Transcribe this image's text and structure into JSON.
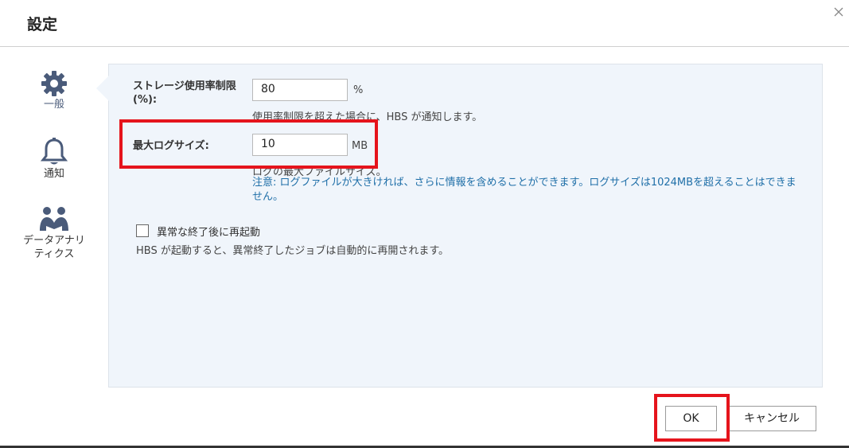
{
  "dialog": {
    "title": "設定"
  },
  "nav": {
    "items": [
      {
        "label": "一般",
        "icon": "gear-icon",
        "active": true
      },
      {
        "label": "通知",
        "icon": "bell-icon",
        "active": false
      },
      {
        "label_line1": "データアナリ",
        "label_line2": "ティクス",
        "icon": "people-icon",
        "active": false
      }
    ]
  },
  "storage": {
    "label_line1": "ストレージ使用率制限",
    "label_line2": "(%):",
    "value": "80",
    "unit": "%",
    "hint": "使用率制限を超えた場合に、HBS が通知します。"
  },
  "log": {
    "label": "最大ログサイズ:",
    "value": "10",
    "unit": "MB",
    "hint": "ログの最大ファイルサイズ。",
    "note_line1": "注意: ログファイルが大きければ、さらに情報を含めることができます。ログサイズは1024MBを超えることはできま",
    "note_line2": "せん。"
  },
  "restart": {
    "checked": false,
    "label": "異常な終了後に再起動",
    "description": "HBS が起動すると、異常終了したジョブは自動的に再開されます。"
  },
  "buttons": {
    "ok": "OK",
    "cancel": "キャンセル"
  },
  "colors": {
    "highlight": "#e5141c",
    "panel_bg": "#f0f5fb",
    "note_text": "#1f6fa8",
    "icon": "#4a5b7a"
  }
}
